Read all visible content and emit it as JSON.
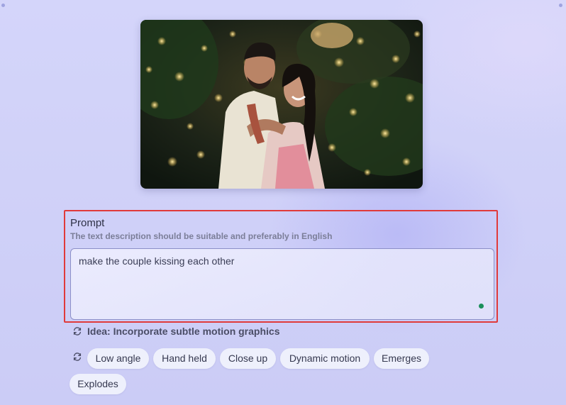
{
  "prompt": {
    "title": "Prompt",
    "subtitle": "The text description should be suitable and preferably in English",
    "value": "make the couple kissing each other"
  },
  "idea": {
    "text": "Idea: Incorporate subtle motion graphics"
  },
  "chips": [
    "Low angle",
    "Hand held",
    "Close up",
    "Dynamic motion",
    "Emerges",
    "Explodes"
  ],
  "icons": {
    "refresh": "refresh-icon",
    "status": "status-dot-icon"
  },
  "colors": {
    "highlight_border": "#e03a3a",
    "status_dot": "#1b8f5a",
    "background": "#d0d1f8"
  }
}
